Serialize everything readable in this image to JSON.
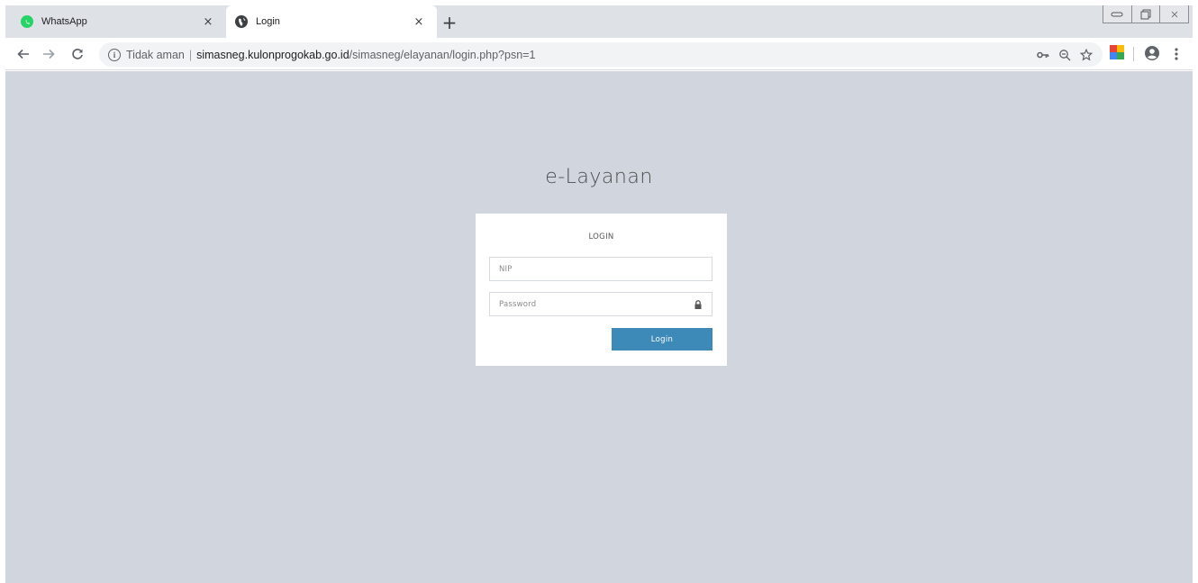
{
  "browser": {
    "tabs": [
      {
        "title": "WhatsApp",
        "favicon": "whatsapp-icon",
        "active": false
      },
      {
        "title": "Login",
        "favicon": "globe-icon",
        "active": true
      }
    ],
    "new_tab_label": "+",
    "close_glyph": "×",
    "address_bar": {
      "security_label": "Tidak aman",
      "separator": "|",
      "host": "simasneg.kulonprogokab.go.id",
      "path": "/simasneg/elayanan/login.php?psn=1"
    },
    "icons": [
      "back-icon",
      "forward-icon",
      "reload-icon",
      "info-icon",
      "key-icon",
      "zoom-icon",
      "star-icon",
      "extension-icon",
      "profile-icon",
      "menu-icon"
    ],
    "colors": {
      "tabstrip": "#dee1e6",
      "omnibox": "#f1f3f4"
    }
  },
  "page": {
    "brand": "e-Layanan",
    "login_title": "LOGIN",
    "nip_placeholder": "NIP",
    "password_placeholder": "Password",
    "login_button": "Login",
    "colors": {
      "background": "#d0d5de",
      "button": "#3d8ab8",
      "card": "#ffffff"
    }
  }
}
